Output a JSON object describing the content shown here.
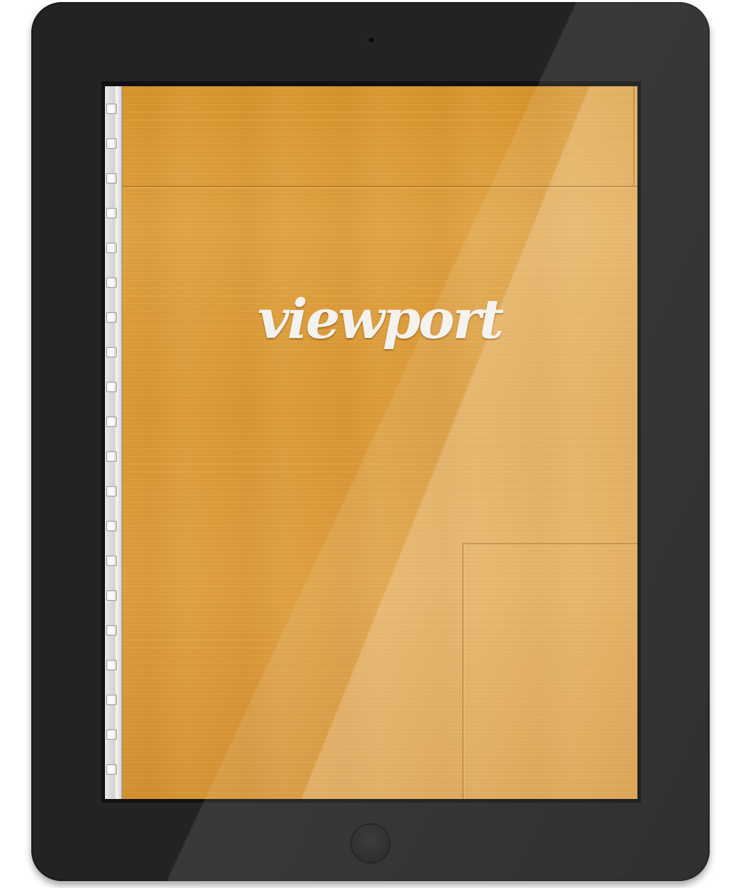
{
  "app": {
    "logo_text": "viewport"
  },
  "device": {
    "frame_color": "#232323",
    "screen_background": "#dc9a36",
    "binder_color": "#e0e0e0"
  },
  "icons": [
    "camera-icon",
    "home-button"
  ]
}
